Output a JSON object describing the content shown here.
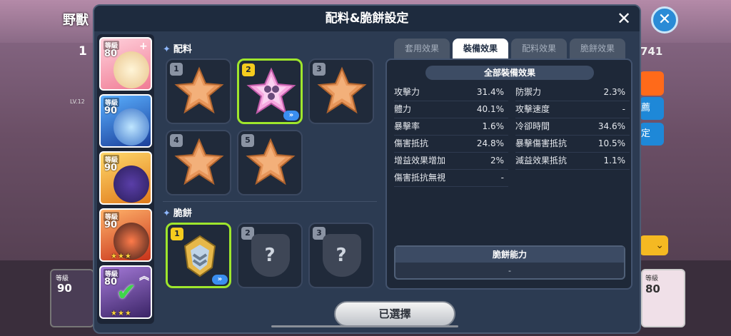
{
  "background": {
    "title": "野獸",
    "left_count": "1",
    "right_count": "741",
    "lv_label": "LV.12",
    "blue_btn1": "薦",
    "blue_btn2": "定",
    "yellow_icon": "⌄",
    "card_left": {
      "level_label": "等級",
      "level": "90"
    },
    "card_right": {
      "level_label": "等級",
      "level": "80"
    },
    "close_icon": "✕"
  },
  "modal": {
    "title": "配料&脆餅設定",
    "close_icon": "✕"
  },
  "characters": [
    {
      "level_label": "等級",
      "level": "80",
      "corner": "+",
      "stars": "",
      "color": "#f07b94"
    },
    {
      "level_label": "等級",
      "level": "90",
      "corner": "",
      "stars": "",
      "color": "#3b6fd8"
    },
    {
      "level_label": "等級",
      "level": "90",
      "corner": "",
      "stars": "",
      "color": "#f5a623"
    },
    {
      "level_label": "等級",
      "level": "90",
      "corner": "",
      "stars": "★★★",
      "color": "#e8532a"
    },
    {
      "level_label": "等級",
      "level": "80",
      "corner": "︽",
      "stars": "★★★",
      "color": "#7a4ab8"
    }
  ],
  "toppings": {
    "label": "配料",
    "slots": [
      {
        "number": "1"
      },
      {
        "number": "2"
      },
      {
        "number": "3"
      },
      {
        "number": "4"
      },
      {
        "number": "5"
      }
    ],
    "expand_icon": "»"
  },
  "biscuit": {
    "label": "脆餅",
    "slots": [
      {
        "number": "1"
      },
      {
        "number": "2",
        "placeholder": "?"
      },
      {
        "number": "3",
        "placeholder": "?"
      }
    ],
    "expand_icon": "»"
  },
  "tabs": [
    "套用效果",
    "裝備效果",
    "配料效果",
    "脆餅效果"
  ],
  "active_tab": "裝備效果",
  "effects": {
    "header": "全部裝備效果",
    "left": [
      {
        "name": "攻擊力",
        "value": "31.4%"
      },
      {
        "name": "體力",
        "value": "40.1%"
      },
      {
        "name": "暴擊率",
        "value": "1.6%"
      },
      {
        "name": "傷害抵抗",
        "value": "24.8%"
      },
      {
        "name": "增益效果增加",
        "value": "2%"
      },
      {
        "name": "傷害抵抗無視",
        "value": "-"
      }
    ],
    "right": [
      {
        "name": "防禦力",
        "value": "2.3%"
      },
      {
        "name": "攻擊速度",
        "value": "-"
      },
      {
        "name": "冷卻時間",
        "value": "34.6%"
      },
      {
        "name": "暴擊傷害抵抗",
        "value": "10.5%"
      },
      {
        "name": "減益效果抵抗",
        "value": "1.1%"
      }
    ]
  },
  "ability": {
    "title": "脆餅能力",
    "value": "-"
  },
  "select_button": "已選擇"
}
